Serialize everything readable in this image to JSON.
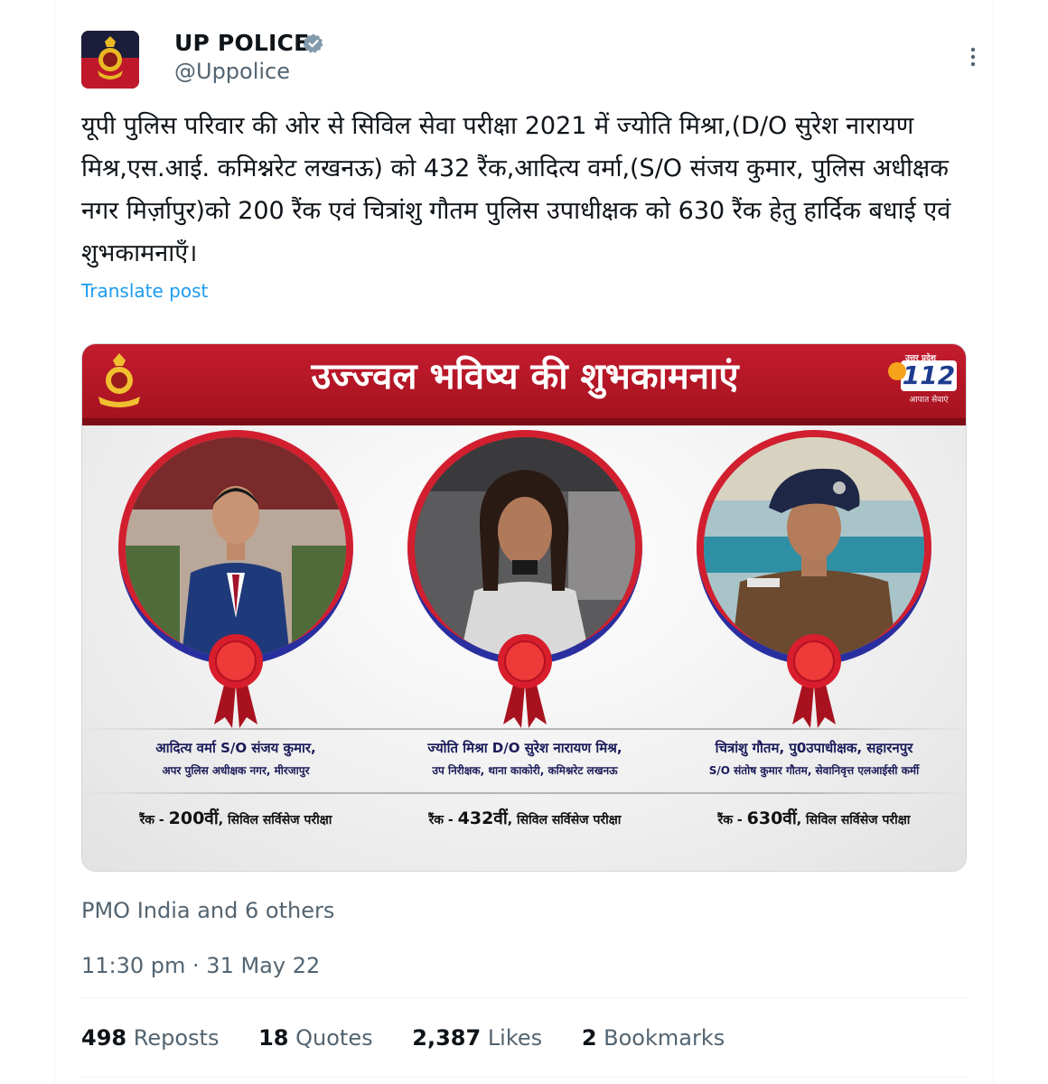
{
  "author": {
    "name": "UP POLICE",
    "handle": "@Uppolice",
    "verified": true,
    "avatar_icon": "up-police-emblem-icon"
  },
  "post": {
    "text": "यूपी पुलिस परिवार की ओर से सिविल सेवा परीक्षा 2021 में ज्योति मिश्रा,(D/O सुरेश नारायण मिश्र,एस.आई. कमिश्नरेट लखनऊ) को 432 रैंक,आदित्य वर्मा,(S/O संजय कुमार, पुलिस अधीक्षक नगर मिर्ज़ापुर)को 200 रैंक एवं चित्रांशु गौतम पुलिस उपाधीक्षक को 630 रैंक हेतु हार्दिक बधाई एवं शुभकामनाएँ।",
    "translate_label": "Translate post"
  },
  "card": {
    "banner_title": "उज्ज्वल भविष्य की शुभकामनाएं",
    "logo_112": {
      "top": "उत्तर प्रदेश",
      "number": "112",
      "bottom": "आपात सेवाएं"
    },
    "emblem_label": "उत्तर प्रदेश पुलिस",
    "people": [
      {
        "line1": "आदित्य वर्मा S/O संजय कुमार,",
        "line2": "अपर पुलिस अधीक्षक नगर, मीरजापुर",
        "rank_prefix": "रैंक - ",
        "rank_value": "200वीं",
        "rank_suffix": ", सिविल सर्विसेज परीक्षा"
      },
      {
        "line1": "ज्योति मिश्रा D/O सुरेश नारायण मिश्र,",
        "line2": "उप निरीक्षक, थाना काकोरी, कमिश्नरेट लखनऊ",
        "rank_prefix": "रैंक - ",
        "rank_value": "432वीं",
        "rank_suffix": ", सिविल सर्विसेज परीक्षा"
      },
      {
        "line1": "चित्रांशु गौतम, पु0उपाधीक्षक, सहारनपुर",
        "line2": "S/O संतोष कुमार गौतम, सेवानिवृत्त एलआईसी कर्मी",
        "rank_prefix": "रैंक - ",
        "rank_value": "630वीं",
        "rank_suffix": ", सिविल सर्विसेज परीक्षा"
      }
    ]
  },
  "liked_by": "PMO India and 6 others",
  "timestamp": "11:30 pm · 31 May 22",
  "stats": {
    "reposts_count": "498",
    "reposts_label": "Reposts",
    "quotes_count": "18",
    "quotes_label": "Quotes",
    "likes_count": "2,387",
    "likes_label": "Likes",
    "bookmarks_count": "2",
    "bookmarks_label": "Bookmarks"
  },
  "colors": {
    "accent": "#1d9bf0",
    "banner_red": "#c41b2f",
    "ring_blue": "#2a2fa0",
    "muted_text": "#536471"
  }
}
